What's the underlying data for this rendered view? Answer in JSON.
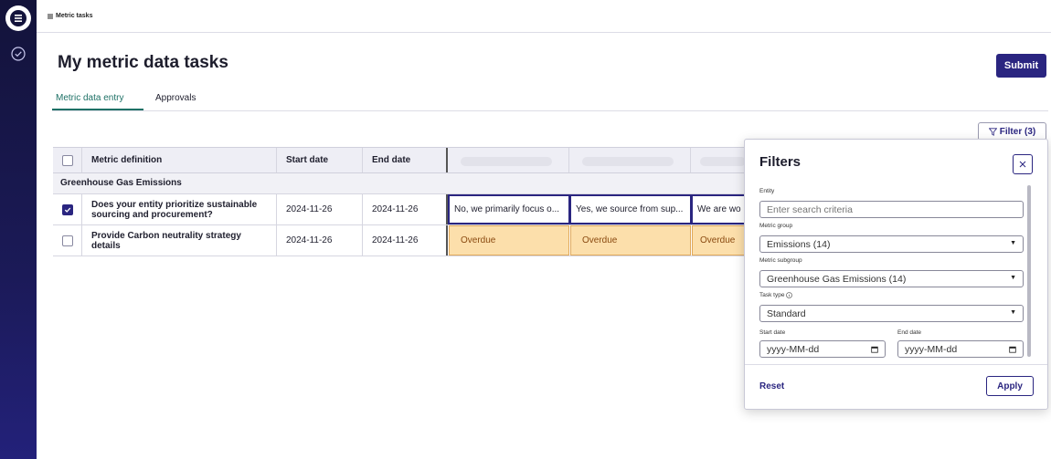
{
  "breadcrumb": {
    "label": "Metric tasks"
  },
  "page": {
    "title": "My metric data tasks",
    "submit_label": "Submit"
  },
  "tabs": [
    {
      "label": "Metric data entry",
      "active": true
    },
    {
      "label": "Approvals",
      "active": false
    }
  ],
  "filter_button": {
    "label": "Filter (3)"
  },
  "table": {
    "headers": {
      "metric": "Metric definition",
      "start": "Start date",
      "end": "End date"
    },
    "group": "Greenhouse Gas Emissions",
    "rows": [
      {
        "checked": true,
        "metric": "Does your entity prioritize sustainable sourcing and procurement?",
        "start": "2024-11-26",
        "end": "2024-11-26",
        "responses": [
          "No, we primarily focus o...",
          "Yes, we source from sup...",
          "We are wo"
        ]
      },
      {
        "checked": false,
        "metric": "Provide Carbon neutrality strategy details",
        "start": "2024-11-26",
        "end": "2024-11-26",
        "responses": [
          "Overdue",
          "Overdue",
          "Overdue"
        ]
      }
    ]
  },
  "filters": {
    "title": "Filters",
    "entity": {
      "label": "Entity",
      "placeholder": "Enter search criteria"
    },
    "metric_group": {
      "label": "Metric group",
      "value": "Emissions (14)"
    },
    "metric_subgroup": {
      "label": "Metric subgroup",
      "value": "Greenhouse Gas Emissions (14)"
    },
    "task_type": {
      "label": "Task type",
      "value": "Standard"
    },
    "start_date": {
      "label": "Start date",
      "placeholder": "yyyy-MM-dd"
    },
    "end_date": {
      "label": "End date",
      "placeholder": "yyyy-MM-dd"
    },
    "reset_label": "Reset",
    "apply_label": "Apply"
  },
  "colors": {
    "accent": "#2a2580",
    "tab_active": "#1e7166",
    "overdue_bg": "#fcdfab",
    "rail": "#1b1a58"
  }
}
